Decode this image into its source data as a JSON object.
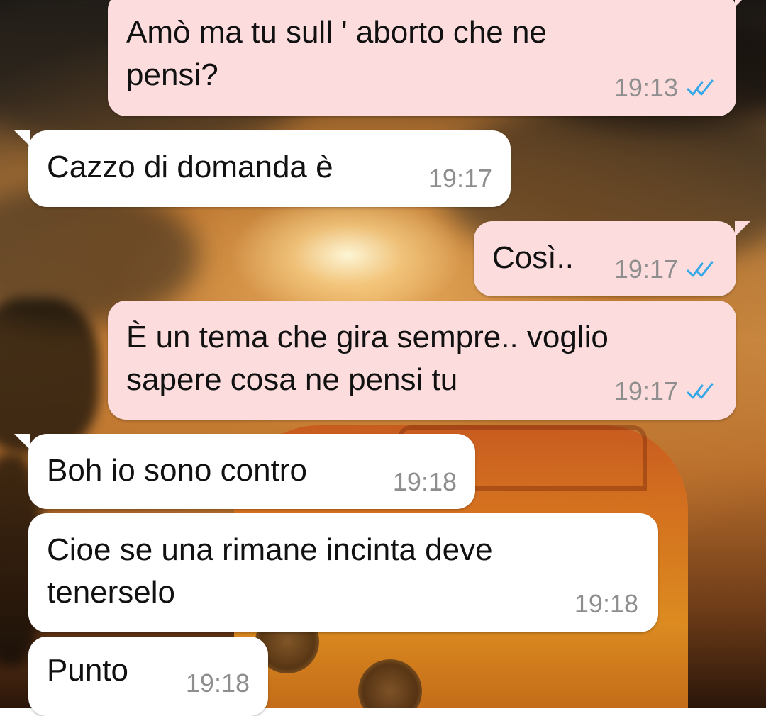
{
  "messages": [
    {
      "direction": "outgoing",
      "text": "Amò ma tu sull ' aborto che ne\npensi?",
      "time": "19:13",
      "status": "read-double-check-icon"
    },
    {
      "direction": "incoming",
      "text": "Cazzo di domanda è",
      "time": "19:17"
    },
    {
      "direction": "outgoing",
      "text": "Così..",
      "time": "19:17",
      "status": "read-double-check-icon"
    },
    {
      "direction": "outgoing",
      "text": "È un tema che gira sempre.. voglio\nsapere cosa ne pensi tu",
      "time": "19:17",
      "status": "read-double-check-icon"
    },
    {
      "direction": "incoming",
      "text": "Boh io sono contro",
      "time": "19:18"
    },
    {
      "direction": "incoming",
      "text": "Cioe se una rimane incinta deve\ntenerselo",
      "time": "19:18"
    },
    {
      "direction": "incoming",
      "text": "Punto",
      "time": "19:18"
    }
  ],
  "colors": {
    "outgoing_bubble": "#fcdcdc",
    "incoming_bubble": "#ffffff",
    "read_ticks": "#34a7e8",
    "timestamp": "#8e8e8e"
  }
}
